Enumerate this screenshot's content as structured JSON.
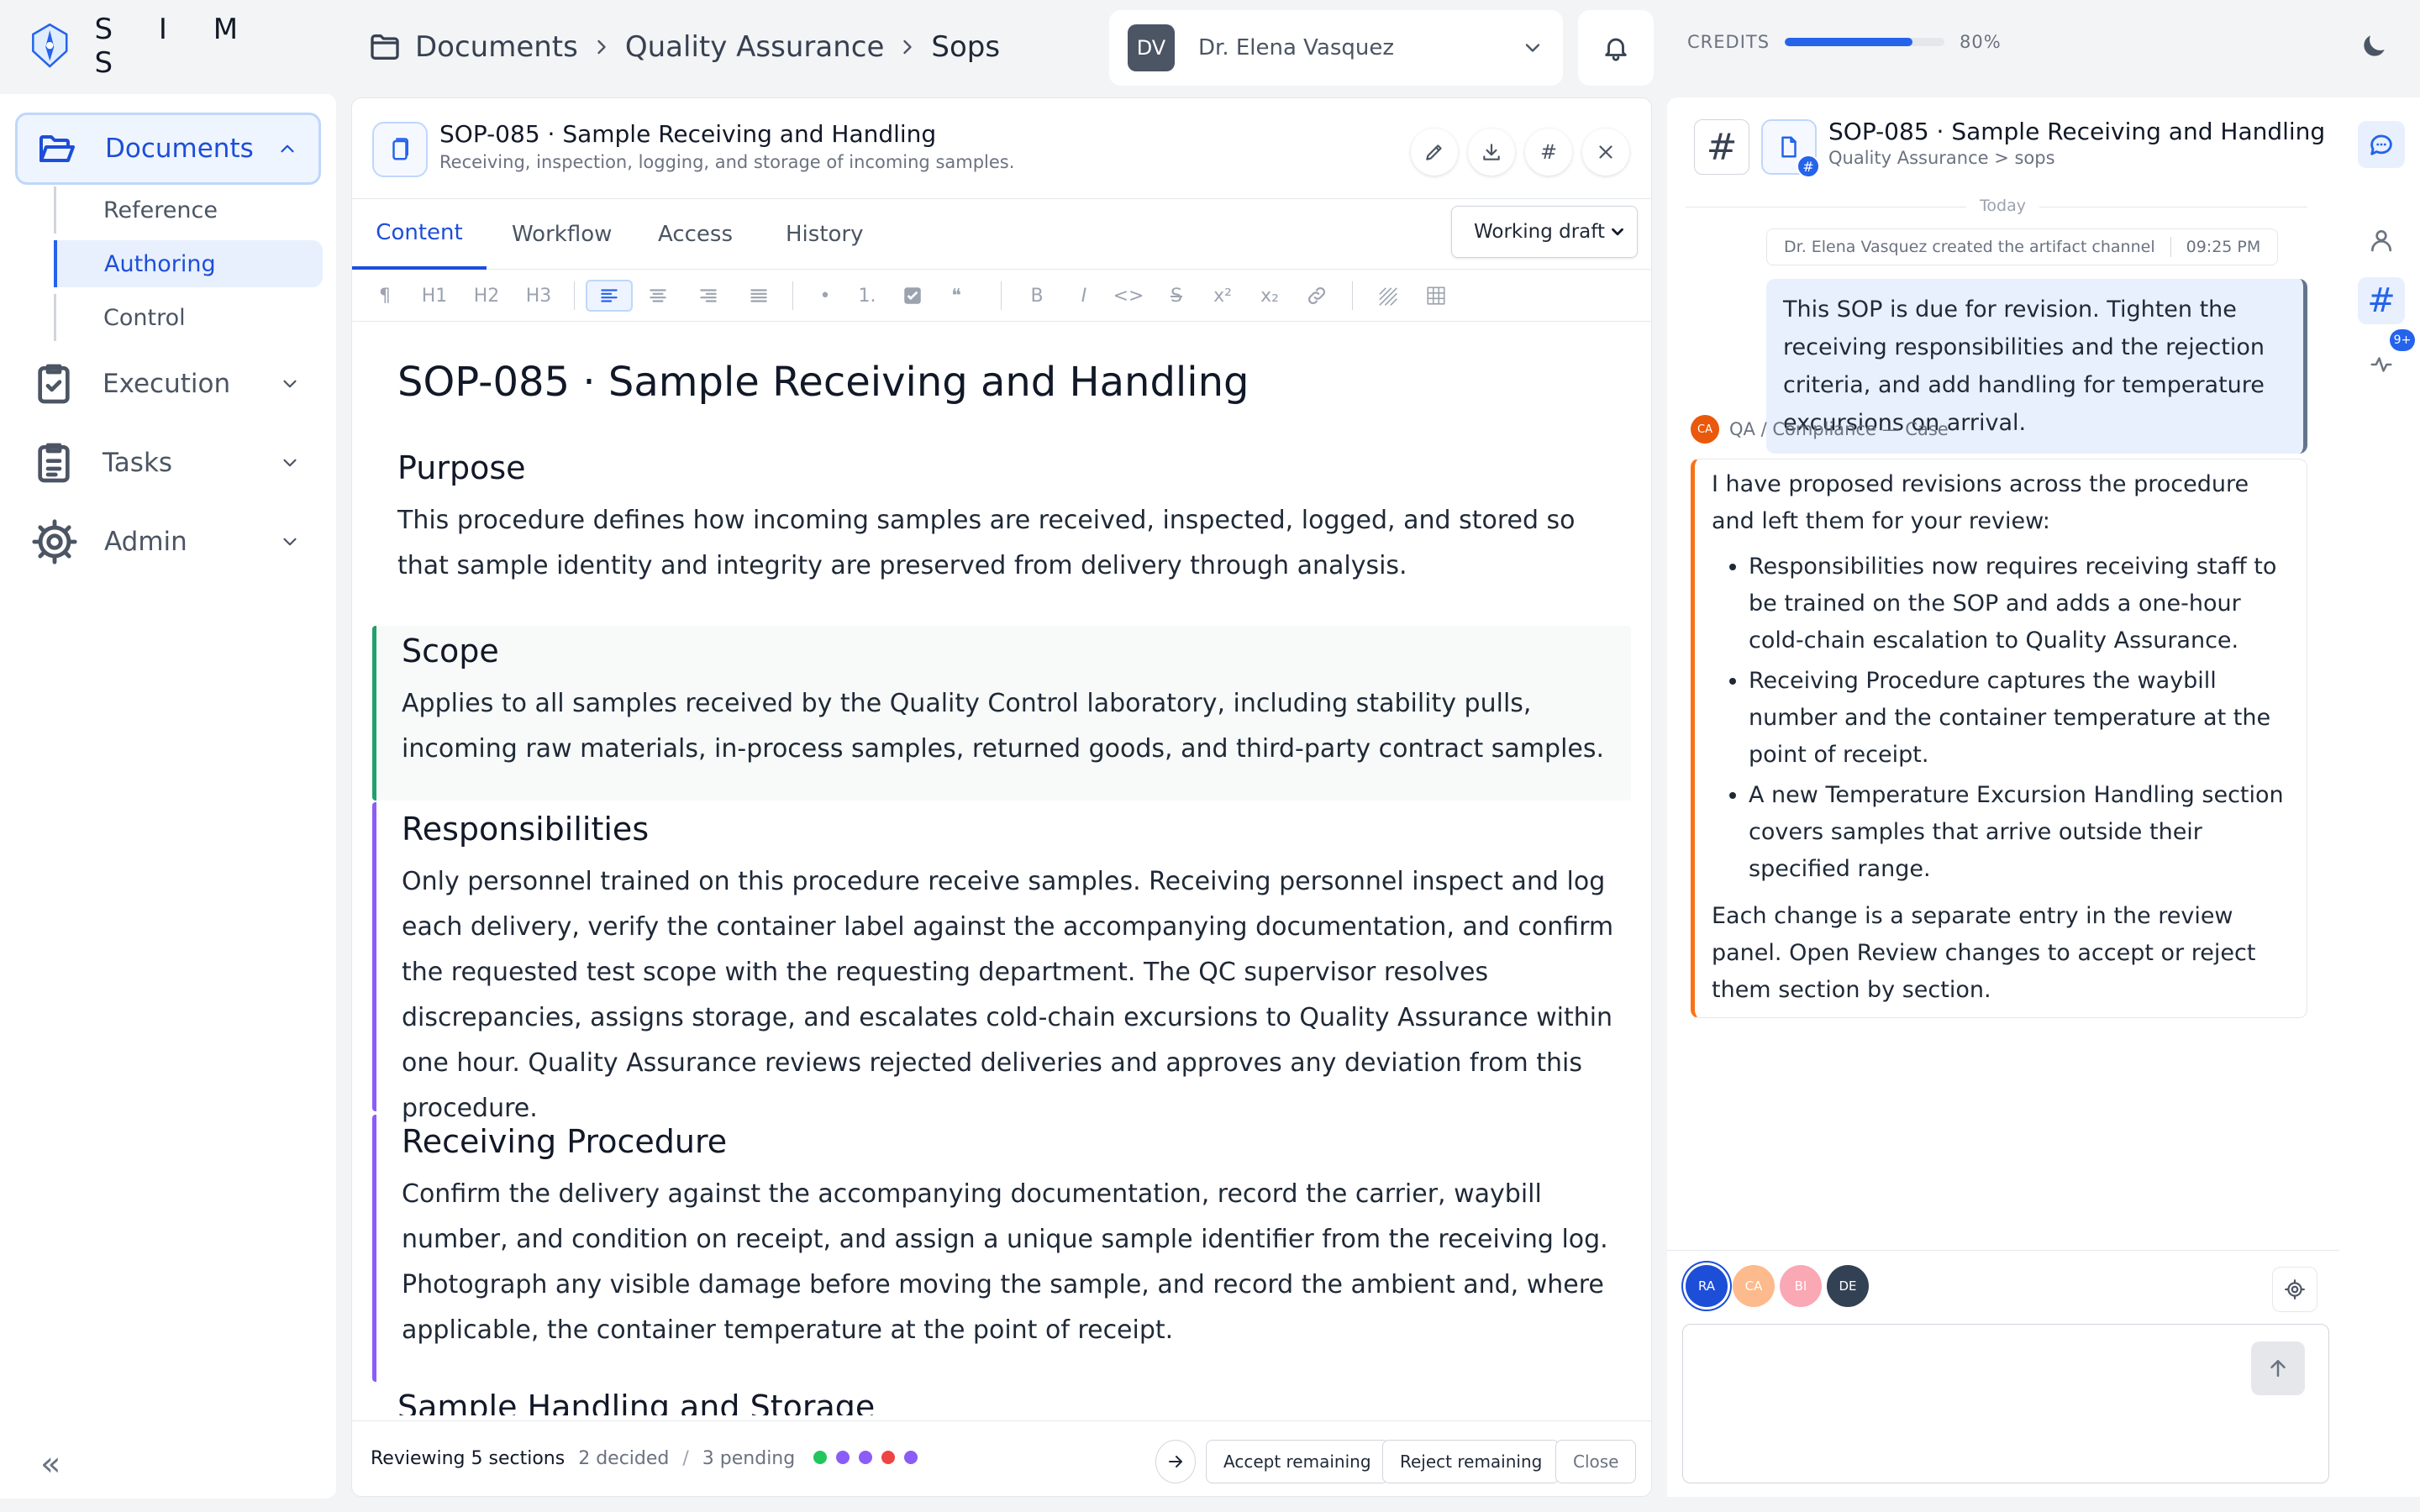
{
  "app": {
    "logo_text": "S I M S"
  },
  "breadcrumb": [
    "Documents",
    "Quality Assurance",
    "Sops"
  ],
  "user": {
    "initials": "DV",
    "name": "Dr. Elena Vasquez"
  },
  "credits": {
    "label": "CREDITS",
    "percent_text": "80%",
    "percent": 80
  },
  "sidebar": {
    "items": [
      {
        "label": "Documents"
      },
      {
        "label": "Execution"
      },
      {
        "label": "Tasks"
      },
      {
        "label": "Admin"
      }
    ],
    "subitems": [
      {
        "label": "Reference"
      },
      {
        "label": "Authoring"
      },
      {
        "label": "Control"
      }
    ],
    "collapse_icon": "«"
  },
  "doc": {
    "title": "SOP-085 · Sample Receiving and Handling",
    "subtitle": "Receiving, inspection, logging, and storage of incoming samples.",
    "header_actions": {
      "hash": "#"
    }
  },
  "tabs": [
    "Content",
    "Workflow",
    "Access",
    "History"
  ],
  "draft_select": "Working draft",
  "toolbar": {
    "para": "¶",
    "h1": "H1",
    "h2": "H2",
    "h3": "H3",
    "bullet": "•",
    "numbered": "1.",
    "quote": "❝",
    "bold": "B",
    "italic": "I",
    "code": "<>",
    "strike": "S",
    "sup": "x²",
    "sub": "x₂"
  },
  "content": {
    "h1": "SOP-085 · Sample Receiving and Handling",
    "sections": [
      {
        "heading": "Purpose",
        "body": "This procedure defines how incoming samples are received, inspected, logged, and stored so that sample identity and integrity are preserved from delivery through analysis."
      },
      {
        "heading": "Scope",
        "body": "Applies to all samples received by the Quality Control laboratory, including stability pulls, incoming raw materials, in-process samples, returned goods, and third-party contract samples."
      },
      {
        "heading": "Responsibilities",
        "body": "Only personnel trained on this procedure receive samples. Receiving personnel inspect and log each delivery, verify the container label against the accompanying documentation, and confirm the requested test scope with the requesting department. The QC supervisor resolves discrepancies, assigns storage, and escalates cold-chain excursions to Quality Assurance within one hour. Quality Assurance reviews rejected deliveries and approves any deviation from this procedure."
      },
      {
        "heading": "Receiving Procedure",
        "body": "Confirm the delivery against the accompanying documentation, record the carrier, waybill number, and condition on receipt, and assign a unique sample identifier from the receiving log. Photograph any visible damage before moving the sample, and record the ambient and, where applicable, the container temperature at the point of receipt."
      },
      {
        "heading": "Sample Handling and Storage",
        "body": ""
      }
    ]
  },
  "review": {
    "label": "Reviewing 5 sections",
    "decided": "2 decided",
    "sep": "/",
    "pending": "3 pending",
    "dot_colors": [
      "#22c55e",
      "#8b5cf6",
      "#8b5cf6",
      "#ef4444",
      "#8b5cf6"
    ],
    "accept": "Accept remaining",
    "reject": "Reject remaining",
    "close": "Close"
  },
  "panel": {
    "hash": "#",
    "title": "SOP-085 · Sample Receiving and Handling",
    "subtitle": "Quality Assurance > sops",
    "doc_badge": "#",
    "today": "Today",
    "system_msg": "Dr. Elena Vasquez created the artifact channel",
    "system_time": "09:25 PM",
    "user_msg": "This SOP is due for revision. Tighten the receiving responsibilities and the rejection criteria, and add handling for temperature excursions on arrival.",
    "agent_initials": "CA",
    "agent_name": "QA / Compliance — Case",
    "agent_intro": "I have proposed revisions across the procedure and left them for your review:",
    "agent_bullets": [
      "Responsibilities now requires receiving staff to be trained on the SOP and adds a one-hour cold-chain escalation to Quality Assurance.",
      "Receiving Procedure captures the waybill number and the container temperature at the point of receipt.",
      "A new Temperature Excursion Handling section covers samples that arrive outside their specified range."
    ],
    "agent_outro": "Each change is a separate entry in the review panel. Open Review changes to accept or reject them section by section.",
    "participants": [
      {
        "initials": "RA",
        "color": "#1d4ed8"
      },
      {
        "initials": "CA",
        "color": "#fdba8c"
      },
      {
        "initials": "BI",
        "color": "#f9a8b4"
      },
      {
        "initials": "DE",
        "color": "#334155"
      }
    ]
  },
  "rail": {
    "badge": "9+"
  }
}
